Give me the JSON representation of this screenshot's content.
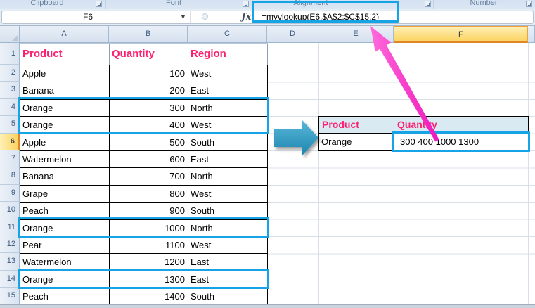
{
  "ribbon": {
    "groups": [
      {
        "label": "Clipboard"
      },
      {
        "label": "Font"
      },
      {
        "label": "Alignment"
      },
      {
        "label": "Number"
      }
    ]
  },
  "formula_bar": {
    "name_box_value": "F6",
    "fx_label": "ƒx",
    "formula": "=myvlookup(E6,$A$2:$C$15,2)"
  },
  "sheet": {
    "column_headers": [
      "A",
      "B",
      "C",
      "D",
      "E",
      "F"
    ],
    "row_numbers": [
      "1",
      "2",
      "3",
      "4",
      "5",
      "6",
      "7",
      "8",
      "9",
      "10",
      "11",
      "12",
      "13",
      "14",
      "15"
    ],
    "selected_cell": "F6",
    "selected_column": "F",
    "selected_row": "6",
    "main_table": {
      "headers": [
        "Product",
        "Quantity",
        "Region"
      ],
      "rows": [
        [
          "Apple",
          "100",
          "West"
        ],
        [
          "Banana",
          "200",
          "East"
        ],
        [
          "Orange",
          "300",
          "North"
        ],
        [
          "Orange",
          "400",
          "West"
        ],
        [
          "Apple",
          "500",
          "South"
        ],
        [
          "Watermelon",
          "600",
          "East"
        ],
        [
          "Banana",
          "700",
          "North"
        ],
        [
          "Grape",
          "800",
          "West"
        ],
        [
          "Peach",
          "900",
          "South"
        ],
        [
          "Orange",
          "1000",
          "North"
        ],
        [
          "Pear",
          "1100",
          "West"
        ],
        [
          "Watermelon",
          "1200",
          "East"
        ],
        [
          "Orange",
          "1300",
          "East"
        ],
        [
          "Peach",
          "1400",
          "South"
        ]
      ]
    },
    "result_table": {
      "headers": [
        "Product",
        "Quantity"
      ],
      "rows": [
        [
          "Orange",
          "300 400 1000 1300"
        ]
      ]
    },
    "highlights": {
      "boxed_ranges": [
        "A4:C5",
        "A11:C11",
        "A14:C14",
        "F6"
      ],
      "box_color": "#17A4E6"
    }
  },
  "colors": {
    "header_text_pink": "#FB2171",
    "highlight_box_blue": "#17A4E6",
    "selected_header_yellow": "#FBD35F",
    "result_header_fill": "#D9EAF2",
    "magenta_arrow": "#EE17BC",
    "block_arrow_blue": "#2E9ABE"
  }
}
